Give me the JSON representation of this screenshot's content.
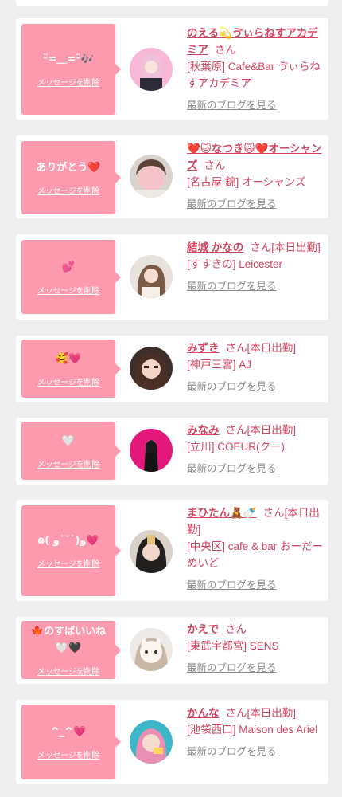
{
  "colors": {
    "accent": "#d2445f",
    "bubble": "#fe9aad",
    "background": "#efefef"
  },
  "entries": [
    {
      "message": "ᵕ̈=＿=ᵕ̈🎶",
      "delete_label": "メッセージを削除",
      "name": "のえる💫ゔぃらねすアカデミア",
      "suffix": "さん",
      "location": "[秋葉原] Cafe&Bar ゔぃらねすアカデミア",
      "blog_label": "最新のブログを見る",
      "avatar_icon": "avatar-photo-icon"
    },
    {
      "message": "ありがとう❤️",
      "delete_label": "メッセージを削除",
      "name": "❤️🐱なつき🙀❤️オーシャンズ",
      "suffix": "さん",
      "location": "[名古屋 錦] オーシャンズ",
      "blog_label": "最新のブログを見る",
      "avatar_icon": "avatar-photo-icon"
    },
    {
      "message": "💕",
      "delete_label": "メッセージを削除",
      "name": "結城 かなの",
      "suffix": "さん[本日出勤]",
      "location": "[すすきの] Leicester",
      "blog_label": "最新のブログを見る",
      "avatar_icon": "avatar-photo-icon"
    },
    {
      "message": "🥰💗",
      "delete_label": "メッセージを削除",
      "name": "みずき",
      "suffix": "さん[本日出勤]",
      "location": "[神戸三宮] AJ",
      "blog_label": "最新のブログを見る",
      "avatar_icon": "avatar-photo-icon"
    },
    {
      "message": "🤍",
      "delete_label": "メッセージを削除",
      "name": "みなみ",
      "suffix": "さん[本日出勤]",
      "location": "[立川] COEUR(クー)",
      "blog_label": "最新のブログを見る",
      "avatar_icon": "avatar-photo-icon"
    },
    {
      "message": "ɷ( و˙˘˙)و💗",
      "delete_label": "メッセージを削除",
      "name": "まひたん🧸🍼",
      "suffix": "さん[本日出勤]",
      "location": "[中央区] cafe & bar おーだーめいど",
      "blog_label": "最新のブログを見る",
      "avatar_icon": "avatar-photo-icon"
    },
    {
      "message": "🍁のすばいいね\n🤍🖤",
      "delete_label": "メッセージを削除",
      "name": "かえで",
      "suffix": "さん",
      "location": "[東武宇都宮] SENS",
      "blog_label": "最新のブログを見る",
      "avatar_icon": "avatar-photo-icon"
    },
    {
      "message": "^_^💗",
      "delete_label": "メッセージを削除",
      "name": "かんな",
      "suffix": "さん[本日出勤]",
      "location": "[池袋西口] Maison des Ariel",
      "blog_label": "最新のブログを見る",
      "avatar_icon": "avatar-photo-icon"
    }
  ]
}
